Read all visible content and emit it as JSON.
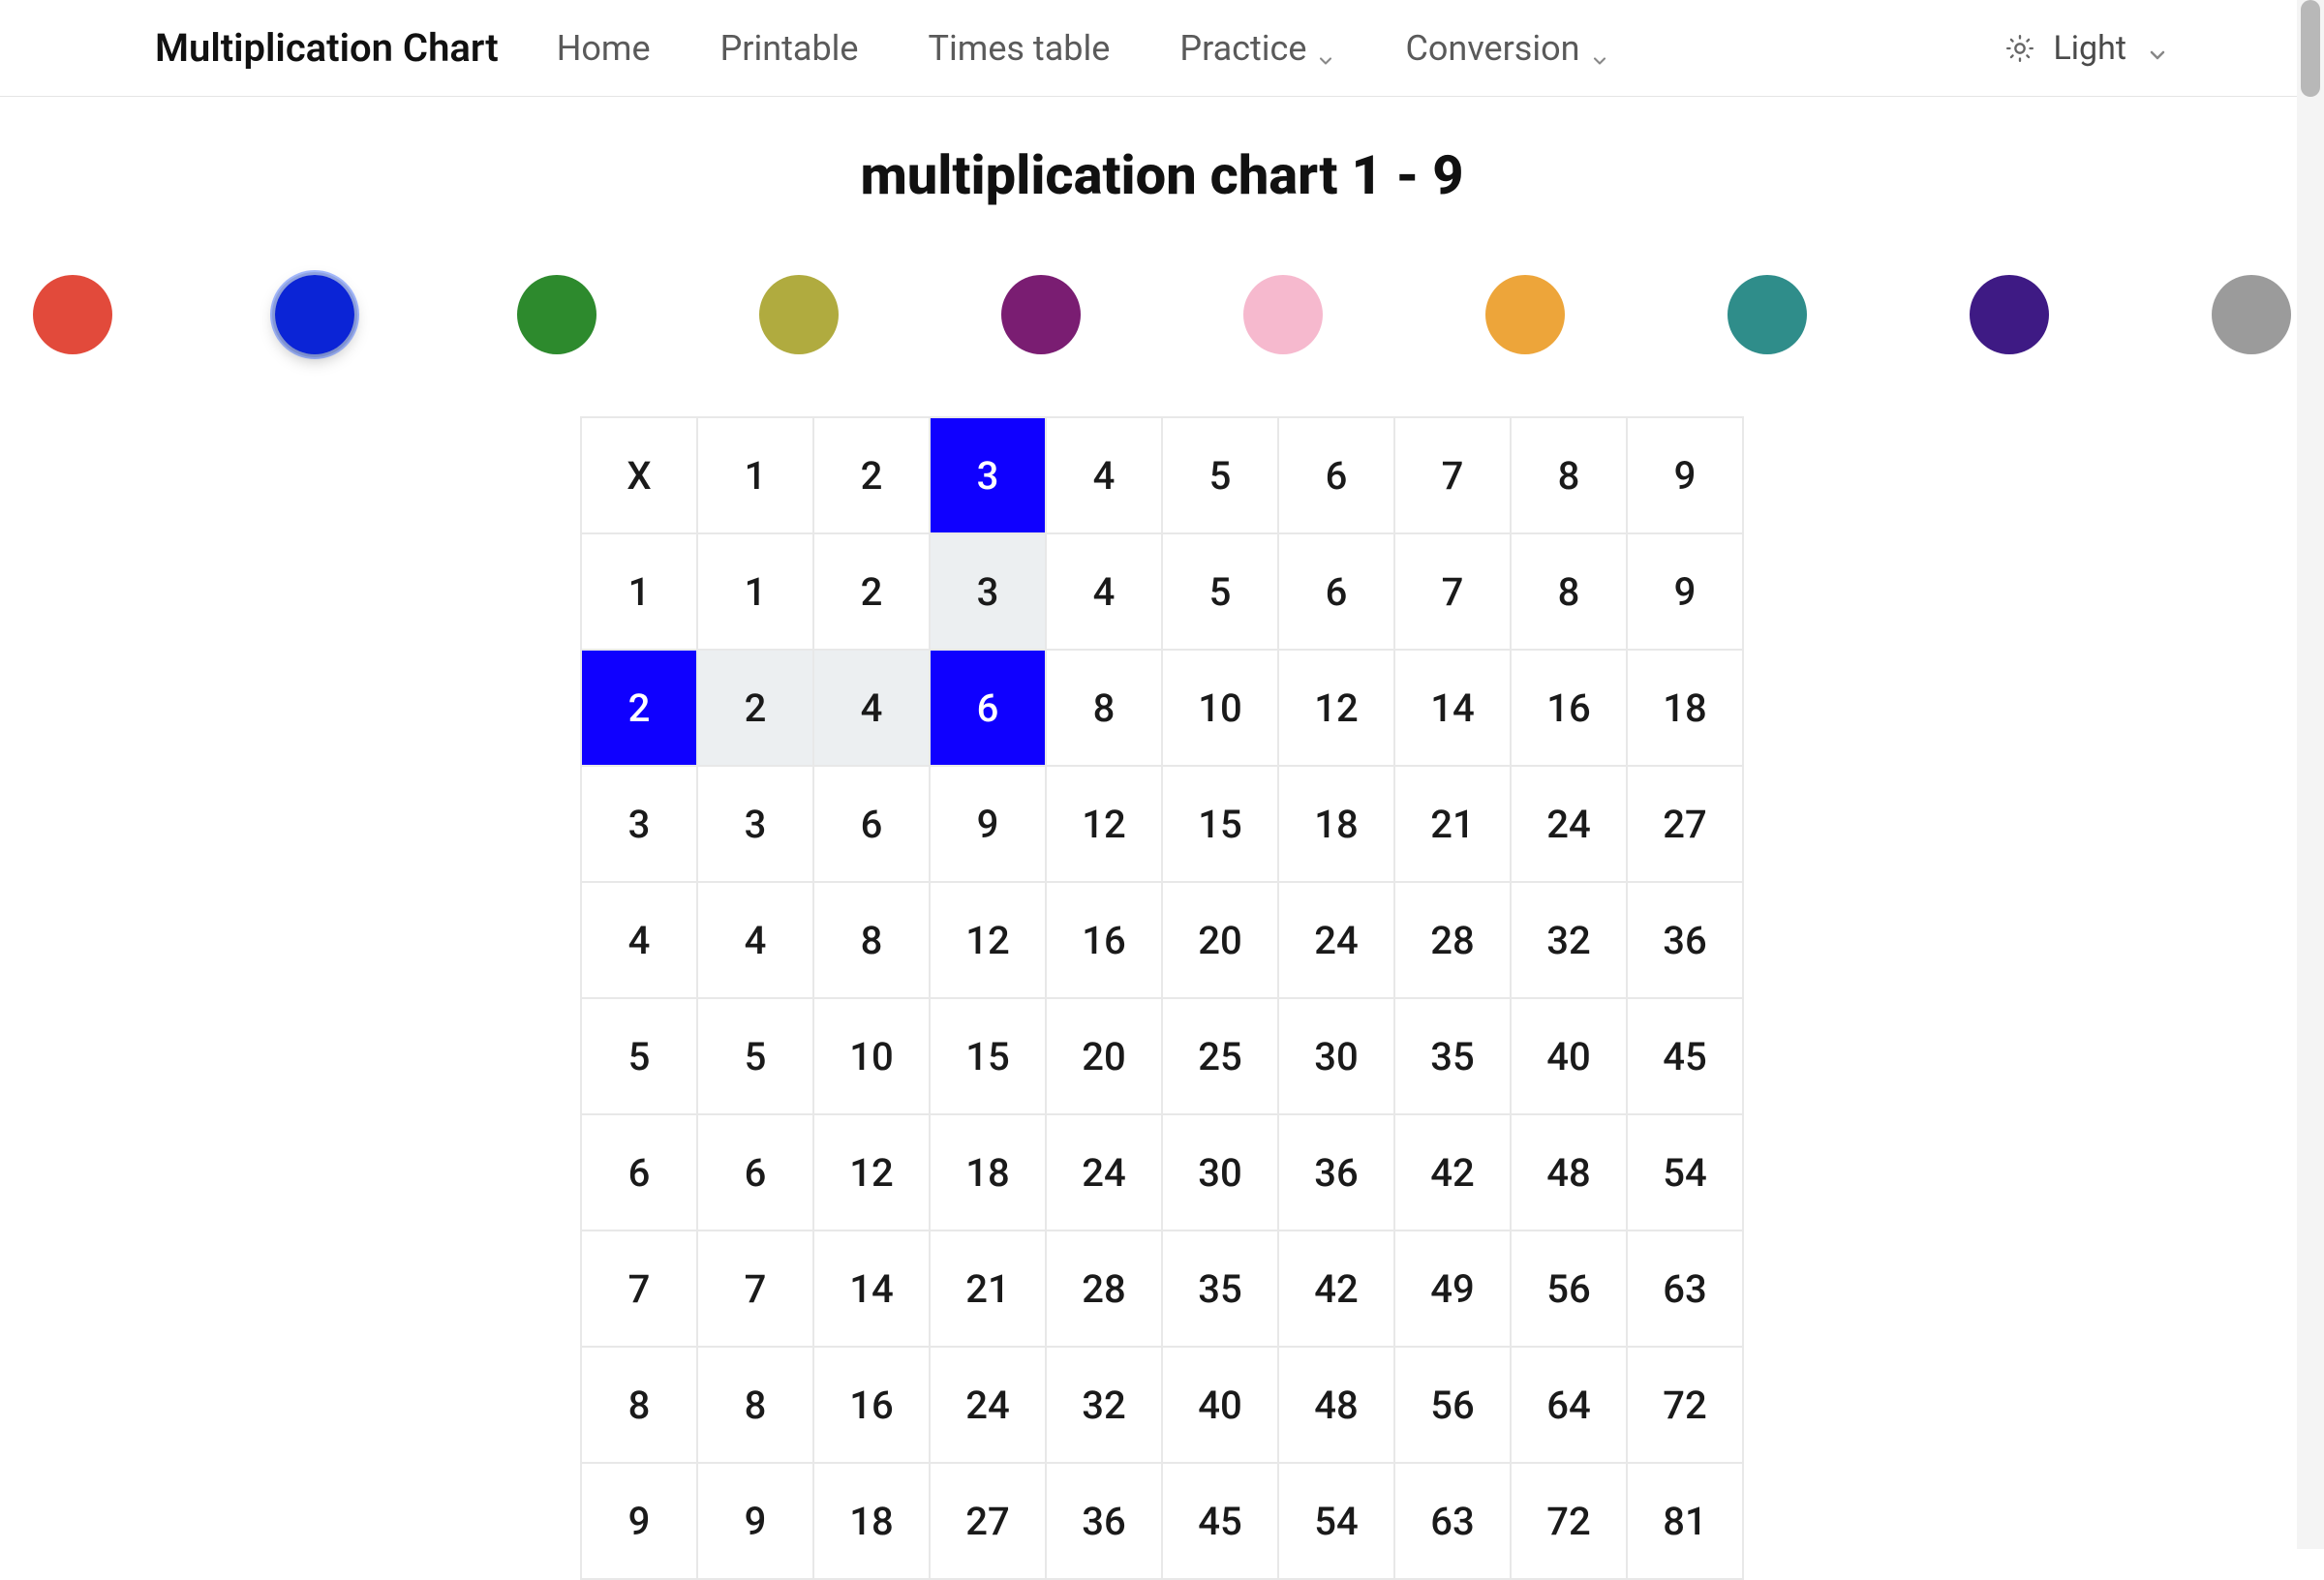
{
  "header": {
    "brand": "Multiplication Chart",
    "nav": [
      {
        "label": "Home",
        "has_dropdown": false
      },
      {
        "label": "Printable",
        "has_dropdown": false
      },
      {
        "label": "Times table",
        "has_dropdown": false
      },
      {
        "label": "Practice",
        "has_dropdown": true
      },
      {
        "label": "Conversion",
        "has_dropdown": true
      }
    ],
    "theme_label": "Light"
  },
  "title": "multiplication chart 1 - 9",
  "colors": [
    {
      "name": "red",
      "hex": "#e24a3b",
      "selected": false
    },
    {
      "name": "blue",
      "hex": "#0b24d6",
      "selected": true
    },
    {
      "name": "green",
      "hex": "#2d8a2d",
      "selected": false
    },
    {
      "name": "olive",
      "hex": "#b0ab3f",
      "selected": false
    },
    {
      "name": "purple",
      "hex": "#7a1d72",
      "selected": false
    },
    {
      "name": "pink",
      "hex": "#f6b9ce",
      "selected": false
    },
    {
      "name": "orange",
      "hex": "#eda53a",
      "selected": false
    },
    {
      "name": "teal",
      "hex": "#2f8d8a",
      "selected": false
    },
    {
      "name": "violet",
      "hex": "#3e1a84",
      "selected": false
    },
    {
      "name": "gray",
      "hex": "#9b9b9b",
      "selected": false
    }
  ],
  "chart_data": {
    "type": "table",
    "title": "multiplication chart 1 - 9",
    "size": 9,
    "corner_label": "X",
    "col_headers": [
      1,
      2,
      3,
      4,
      5,
      6,
      7,
      8,
      9
    ],
    "row_headers": [
      1,
      2,
      3,
      4,
      5,
      6,
      7,
      8,
      9
    ],
    "values": [
      [
        1,
        2,
        3,
        4,
        5,
        6,
        7,
        8,
        9
      ],
      [
        2,
        4,
        6,
        8,
        10,
        12,
        14,
        16,
        18
      ],
      [
        3,
        6,
        9,
        12,
        15,
        18,
        21,
        24,
        27
      ],
      [
        4,
        8,
        12,
        16,
        20,
        24,
        28,
        32,
        36
      ],
      [
        5,
        10,
        15,
        20,
        25,
        30,
        35,
        40,
        45
      ],
      [
        6,
        12,
        18,
        24,
        30,
        36,
        42,
        48,
        54
      ],
      [
        7,
        14,
        21,
        28,
        35,
        42,
        49,
        56,
        63
      ],
      [
        8,
        16,
        24,
        32,
        40,
        48,
        56,
        64,
        72
      ],
      [
        9,
        18,
        27,
        36,
        45,
        54,
        63,
        72,
        81
      ]
    ],
    "highlight": {
      "color_hex": "#0f00ff",
      "soft_hex": "#eceff1",
      "selected_row": 2,
      "selected_col": 3,
      "primary_cells": [
        {
          "r": 0,
          "c": 3
        },
        {
          "r": 2,
          "c": 0
        },
        {
          "r": 2,
          "c": 3
        }
      ],
      "soft_cells": [
        {
          "r": 1,
          "c": 3
        },
        {
          "r": 2,
          "c": 1
        },
        {
          "r": 2,
          "c": 2
        }
      ]
    }
  }
}
